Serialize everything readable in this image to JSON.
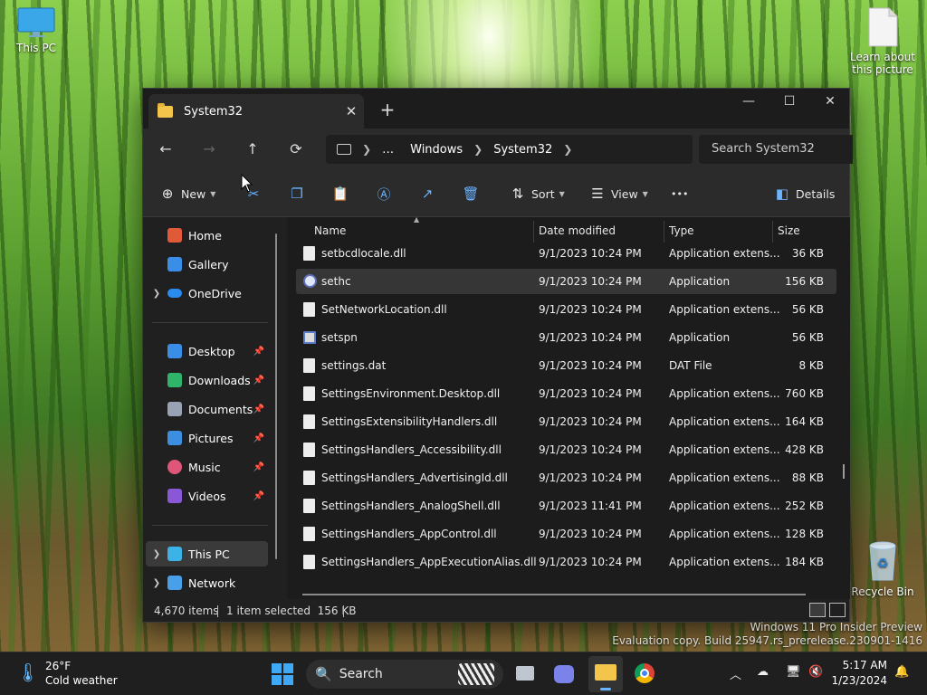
{
  "desktop": {
    "this_pc": "This PC",
    "learn": "Learn about this picture",
    "recycle": "Recycle Bin"
  },
  "window": {
    "tab_title": "System32",
    "new_tab": "+",
    "close_tab": "✕",
    "minimize": "—",
    "maximize": "☐",
    "close": "✕"
  },
  "nav": {
    "back": "←",
    "forward": "→",
    "up": "↑",
    "refresh": "⟳",
    "breadcrumb": [
      "…",
      "Windows",
      "System32"
    ],
    "search_placeholder": "Search System32"
  },
  "toolbar": {
    "new_label": "New",
    "sort_label": "Sort",
    "view_label": "View",
    "more_label": "•••",
    "details_label": "Details"
  },
  "sidebar": {
    "items": [
      {
        "label": "Home",
        "icon": "home-icon",
        "color": "#e05a3a"
      },
      {
        "label": "Gallery",
        "icon": "gallery-icon",
        "color": "#3b8ee6"
      },
      {
        "label": "OneDrive",
        "icon": "cloud-icon",
        "color": "#2b8cf0"
      },
      {
        "label": "Desktop",
        "icon": "desktop-icon",
        "color": "#3b8ee6"
      },
      {
        "label": "Downloads",
        "icon": "download-icon",
        "color": "#2fb56a"
      },
      {
        "label": "Documents",
        "icon": "document-icon",
        "color": "#9aa3b5"
      },
      {
        "label": "Pictures",
        "icon": "picture-icon",
        "color": "#3c8fe0"
      },
      {
        "label": "Music",
        "icon": "music-icon",
        "color": "#e0567a"
      },
      {
        "label": "Videos",
        "icon": "video-icon",
        "color": "#8a58d6"
      },
      {
        "label": "This PC",
        "icon": "pc-icon",
        "color": "#3db2e6"
      },
      {
        "label": "Network",
        "icon": "network-icon",
        "color": "#4aa0e8"
      }
    ]
  },
  "columns": {
    "name": "Name",
    "date": "Date modified",
    "type": "Type",
    "size": "Size"
  },
  "files": [
    {
      "name": "setbcdlocale.dll",
      "date": "9/1/2023 10:24 PM",
      "type": "Application extens...",
      "size": "36 KB",
      "kind": "dll"
    },
    {
      "name": "sethc",
      "date": "9/1/2023 10:24 PM",
      "type": "Application",
      "size": "156 KB",
      "kind": "sethc"
    },
    {
      "name": "SetNetworkLocation.dll",
      "date": "9/1/2023 10:24 PM",
      "type": "Application extens...",
      "size": "56 KB",
      "kind": "dll"
    },
    {
      "name": "setspn",
      "date": "9/1/2023 10:24 PM",
      "type": "Application",
      "size": "56 KB",
      "kind": "app"
    },
    {
      "name": "settings.dat",
      "date": "9/1/2023 10:24 PM",
      "type": "DAT File",
      "size": "8 KB",
      "kind": "file"
    },
    {
      "name": "SettingsEnvironment.Desktop.dll",
      "date": "9/1/2023 10:24 PM",
      "type": "Application extens...",
      "size": "760 KB",
      "kind": "dll"
    },
    {
      "name": "SettingsExtensibilityHandlers.dll",
      "date": "9/1/2023 10:24 PM",
      "type": "Application extens...",
      "size": "164 KB",
      "kind": "dll"
    },
    {
      "name": "SettingsHandlers_Accessibility.dll",
      "date": "9/1/2023 10:24 PM",
      "type": "Application extens...",
      "size": "428 KB",
      "kind": "dll"
    },
    {
      "name": "SettingsHandlers_AdvertisingId.dll",
      "date": "9/1/2023 10:24 PM",
      "type": "Application extens...",
      "size": "88 KB",
      "kind": "dll"
    },
    {
      "name": "SettingsHandlers_AnalogShell.dll",
      "date": "9/1/2023 11:41 PM",
      "type": "Application extens...",
      "size": "252 KB",
      "kind": "dll"
    },
    {
      "name": "SettingsHandlers_AppControl.dll",
      "date": "9/1/2023 10:24 PM",
      "type": "Application extens...",
      "size": "128 KB",
      "kind": "dll"
    },
    {
      "name": "SettingsHandlers_AppExecutionAlias.dll",
      "date": "9/1/2023 10:24 PM",
      "type": "Application extens...",
      "size": "184 KB",
      "kind": "dll"
    }
  ],
  "status": {
    "count": "4,670 items",
    "selection": "1 item selected  156 KB"
  },
  "watermark": {
    "line1": "Windows 11 Pro Insider Preview",
    "line2": "Evaluation copy. Build 25947.rs_prerelease.230901-1416"
  },
  "taskbar": {
    "weather_temp": "26°F",
    "weather_desc": "Cold weather",
    "search": "Search",
    "time": "5:17 AM",
    "date": "1/23/2024"
  }
}
